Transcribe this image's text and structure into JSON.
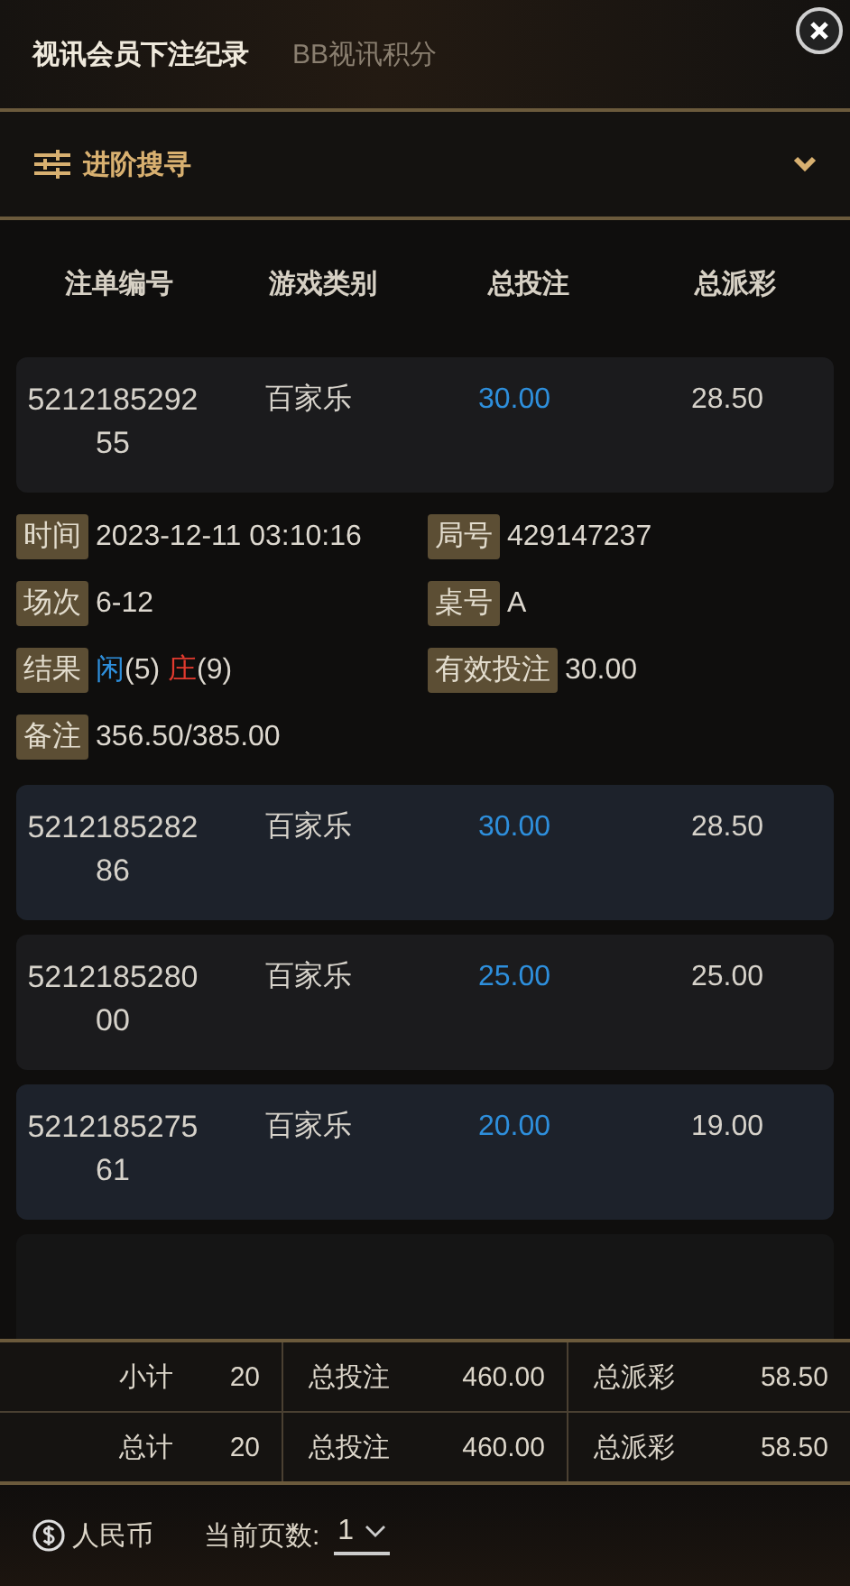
{
  "tabs": [
    {
      "label": "视讯会员下注纪录",
      "selected": true
    },
    {
      "label": "BB视讯积分",
      "selected": false
    }
  ],
  "advanced_search": {
    "label": "进阶搜寻",
    "expanded": false
  },
  "columns": [
    "注单编号",
    "游戏类别",
    "总投注",
    "总派彩"
  ],
  "rows": [
    {
      "id": "521218529255",
      "game": "百家乐",
      "bet": "30.00",
      "payout": "28.50",
      "details": [
        {
          "kind": "text",
          "label": "时间",
          "value": "2023-12-11 03:10:16"
        },
        {
          "kind": "text",
          "label": "局号",
          "value": "429147237"
        },
        {
          "kind": "text",
          "label": "场次",
          "value": "6-12"
        },
        {
          "kind": "text",
          "label": "桌号",
          "value": "A"
        },
        {
          "kind": "result",
          "label": "结果",
          "player_label": "闲",
          "player_score": "(5)",
          "banker_label": "庄",
          "banker_score": "(9)"
        },
        {
          "kind": "text",
          "label": "有效投注",
          "value": "30.00"
        },
        {
          "kind": "text",
          "label": "备注",
          "value": "356.50/385.00"
        }
      ]
    },
    {
      "id": "521218528286",
      "game": "百家乐",
      "bet": "30.00",
      "payout": "28.50"
    },
    {
      "id": "521218528000",
      "game": "百家乐",
      "bet": "25.00",
      "payout": "25.00"
    },
    {
      "id": "521218527561",
      "game": "百家乐",
      "bet": "20.00",
      "payout": "19.00"
    }
  ],
  "totals": [
    {
      "label": "小计",
      "count": "20",
      "bet_label": "总投注",
      "bet": "460.00",
      "payout_label": "总派彩",
      "payout": "58.50"
    },
    {
      "label": "总计",
      "count": "20",
      "bet_label": "总投注",
      "bet": "460.00",
      "payout_label": "总派彩",
      "payout": "58.50"
    }
  ],
  "footer": {
    "currency": "人民币",
    "page_label": "当前页数:",
    "page": "1"
  }
}
